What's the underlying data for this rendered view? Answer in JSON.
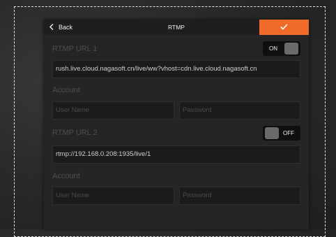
{
  "header": {
    "back_label": "Back",
    "title": "RTMP"
  },
  "rtmp1": {
    "label": "RTMP URL 1",
    "toggle": "ON",
    "url": "rush.live.cloud.nagasoft.cn/live/ww?vhost=cdn.live.cloud.nagasoft.cn",
    "account_label": "Account",
    "username_placeholder": "User Name",
    "password_placeholder": "Password"
  },
  "rtmp2": {
    "label": "RTMP URL 2",
    "toggle": "OFF",
    "url": "rtmp://192.168.0.208:1935/live/1",
    "account_label": "Account",
    "username_placeholder": "User Name",
    "password_placeholder": "Password"
  },
  "colors": {
    "accent": "#f06a2a",
    "panel": "#252525",
    "header": "#1e1e1e"
  },
  "icons": [
    "chevron-left-icon",
    "checkmark-icon"
  ]
}
